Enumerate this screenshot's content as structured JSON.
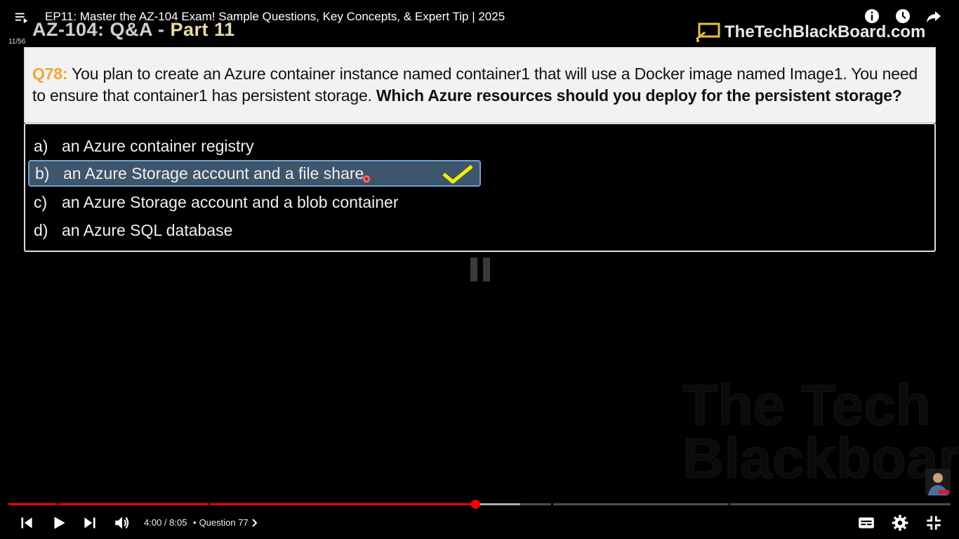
{
  "header": {
    "title": "EP11: Master the AZ-104 Exam! Sample Questions, Key Concepts, & Expert Tip | 2025",
    "playlist_counter": "11/56",
    "icons": [
      "playlist-icon",
      "info-icon",
      "watch-later-icon",
      "share-icon"
    ]
  },
  "slide": {
    "heading_main": "AZ-104: Q&A - ",
    "heading_part": "Part 11",
    "brand": "TheTechBlackBoard.com",
    "question": {
      "number": "Q78:",
      "text": " You plan to create an Azure container instance named container1 that will use a Docker image named Image1. You need to ensure that container1 has persistent storage. ",
      "bold": "Which Azure resources should you deploy for the persistent storage?"
    },
    "answers": [
      {
        "letter": "a)",
        "text": "an Azure container registry",
        "selected": false
      },
      {
        "letter": "b)",
        "text": "an Azure Storage account and a file share",
        "selected": true
      },
      {
        "letter": "c)",
        "text": "an Azure Storage account and a blob container",
        "selected": false
      },
      {
        "letter": "d)",
        "text": "an Azure SQL database",
        "selected": false
      }
    ],
    "watermark_line1": "The Tech",
    "watermark_line2": "Blackboard"
  },
  "player": {
    "progress_fraction": 0.4979,
    "time_current": "4:00",
    "time_total": "8:05",
    "time_display": "4:00 / 8:05",
    "separator": "•",
    "chapter": "Question 77",
    "accent_color": "#ff0000",
    "icons": [
      "previous-icon",
      "play-icon",
      "next-icon",
      "volume-icon",
      "subtitles-icon",
      "settings-icon",
      "exit-fullscreen-icon"
    ]
  }
}
